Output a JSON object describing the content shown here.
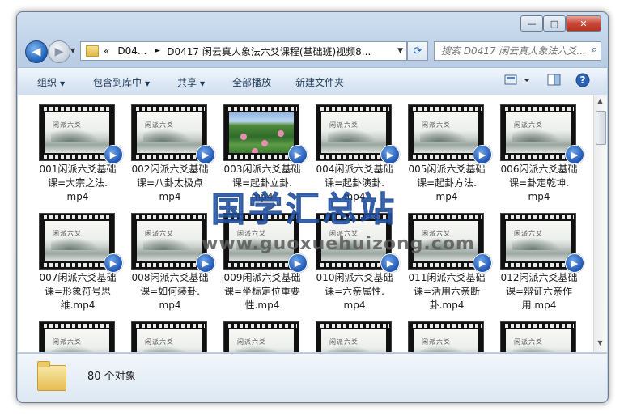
{
  "window": {
    "minimize": "—",
    "maximize": "□",
    "close": "✕"
  },
  "address": {
    "history_symbol": "«",
    "segments": [
      "D04...",
      "D0417 闲云真人象法六爻课程(基础班)视频8..."
    ],
    "separator": "►"
  },
  "search": {
    "placeholder": "搜索 D0417 闲云真人象法六爻..."
  },
  "toolbar": {
    "organize": "组织",
    "include_in_library": "包含到库中",
    "share": "共享",
    "play_all": "全部播放",
    "new_folder": "新建文件夹"
  },
  "files": [
    {
      "name": "001闲派六爻基础课=大宗之法.mp4",
      "line1": "001闲派六爻基础",
      "line2": "课=大宗之法.",
      "line3": "mp4",
      "thumb": "ink"
    },
    {
      "name": "002闲派六爻基础课=八卦太极点.mp4",
      "line1": "002闲派六爻基础",
      "line2": "课=八卦太极点",
      "line3": "mp4",
      "thumb": "ink"
    },
    {
      "name": "003闲派六爻基础课.mp4",
      "line1": "003闲派六爻基础",
      "line2": "课=起卦立卦.",
      "line3": "mp4",
      "thumb": "lotus"
    },
    {
      "name": "004闲派六爻基础课.mp4",
      "line1": "004闲派六爻基础",
      "line2": "课=起卦演卦.",
      "line3": "mp4",
      "thumb": "ink"
    },
    {
      "name": "005闲派六爻基础课=起卦方法.mp4",
      "line1": "005闲派六爻基础",
      "line2": "课=起卦方法.",
      "line3": "mp4",
      "thumb": "ink"
    },
    {
      "name": "006闲派六爻基础课=卦定乾坤.mp4",
      "line1": "006闲派六爻基础",
      "line2": "课=卦定乾坤.",
      "line3": "mp4",
      "thumb": "ink"
    },
    {
      "name": "007闲派六爻基础课=形象符号思维.mp4",
      "line1": "007闲派六爻基础",
      "line2": "课=形象符号思",
      "line3": "维.mp4",
      "thumb": "ink"
    },
    {
      "name": "008闲派六爻基础课=如何装卦.mp4",
      "line1": "008闲派六爻基础",
      "line2": "课=如何装卦.",
      "line3": "mp4",
      "thumb": "ink"
    },
    {
      "name": "009闲派六爻基础课=坐标定位重要性.mp4",
      "line1": "009闲派六爻基础",
      "line2": "课=坐标定位重要",
      "line3": "性.mp4",
      "thumb": "ink"
    },
    {
      "name": "010闲派六爻基础课=六亲属性.mp4",
      "line1": "010闲派六爻基础",
      "line2": "课=六亲属性.",
      "line3": "mp4",
      "thumb": "ink"
    },
    {
      "name": "011闲派六爻基础课=活用六亲断卦.mp4",
      "line1": "011闲派六爻基础",
      "line2": "课=活用六亲断",
      "line3": "卦.mp4",
      "thumb": "ink"
    },
    {
      "name": "012闲派六爻基础课=辩证六亲作用.mp4",
      "line1": "012闲派六爻基础",
      "line2": "课=辩证六亲作",
      "line3": "用.mp4",
      "thumb": "ink"
    }
  ],
  "thumb_title": "闲派六爻",
  "details": {
    "count": "80 个对象"
  },
  "watermark": {
    "title": "国学汇总站",
    "url": "www.guoxuehuizong.com"
  }
}
